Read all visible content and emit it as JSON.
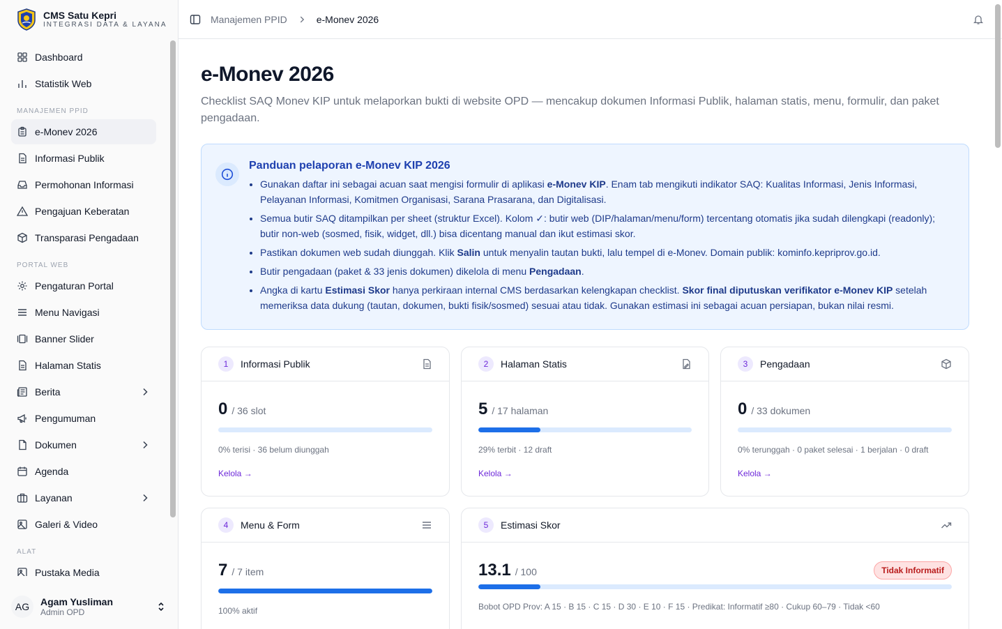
{
  "brand": {
    "title": "CMS Satu Kepri",
    "subtitle": "INTEGRASI DATA & LAYANA..."
  },
  "sidebar": {
    "top": [
      {
        "label": "Dashboard"
      },
      {
        "label": "Statistik Web"
      }
    ],
    "group_ppid": "MANAJEMEN PPID",
    "ppid": [
      {
        "label": "e-Monev 2026"
      },
      {
        "label": "Informasi Publik"
      },
      {
        "label": "Permohonan Informasi"
      },
      {
        "label": "Pengajuan Keberatan"
      },
      {
        "label": "Transparasi Pengadaan"
      }
    ],
    "group_portal": "PORTAL WEB",
    "portal": [
      {
        "label": "Pengaturan Portal"
      },
      {
        "label": "Menu Navigasi"
      },
      {
        "label": "Banner Slider"
      },
      {
        "label": "Halaman Statis"
      },
      {
        "label": "Berita"
      },
      {
        "label": "Pengumuman"
      },
      {
        "label": "Dokumen"
      },
      {
        "label": "Agenda"
      },
      {
        "label": "Layanan"
      },
      {
        "label": "Galeri & Video"
      }
    ],
    "group_alat": "ALAT",
    "alat": [
      {
        "label": "Pustaka Media"
      }
    ]
  },
  "user": {
    "initials": "AG",
    "name": "Agam Yusliman",
    "role": "Admin OPD"
  },
  "breadcrumb": {
    "parent": "Manajemen PPID",
    "current": "e-Monev 2026"
  },
  "page": {
    "title": "e-Monev 2026",
    "description": "Checklist SAQ Monev KIP untuk melaporkan bukti di website OPD — mencakup dokumen Informasi Publik, halaman statis, menu, formulir, dan paket pengadaan."
  },
  "guide": {
    "title": "Panduan pelaporan e-Monev KIP 2026",
    "b1_pre": "Gunakan daftar ini sebagai acuan saat mengisi formulir di aplikasi ",
    "b1_bold": "e-Monev KIP",
    "b1_post": ". Enam tab mengikuti indikator SAQ: Kualitas Informasi, Jenis Informasi, Pelayanan Informasi, Komitmen Organisasi, Sarana Prasarana, dan Digitalisasi.",
    "b2": "Semua butir SAQ ditampilkan per sheet (struktur Excel). Kolom ✓: butir web (DIP/halaman/menu/form) tercentang otomatis jika sudah dilengkapi (readonly); butir non-web (sosmed, fisik, widget, dll.) bisa dicentang manual dan ikut estimasi skor.",
    "b3_pre": "Pastikan dokumen web sudah diunggah. Klik ",
    "b3_bold": "Salin",
    "b3_post": " untuk menyalin tautan bukti, lalu tempel di e-Monev. Domain publik: kominfo.kepriprov.go.id.",
    "b4_pre": "Butir pengadaan (paket & 33 jenis dokumen) dikelola di menu ",
    "b4_bold": "Pengadaan",
    "b4_post": ".",
    "b5_pre": "Angka di kartu ",
    "b5_bold1": "Estimasi Skor",
    "b5_mid": " hanya perkiraan internal CMS berdasarkan kelengkapan checklist. ",
    "b5_bold2": "Skor final diputuskan verifikator e-Monev KIP",
    "b5_post": " setelah memeriksa data dukung (tautan, dokumen, bukti fisik/sosmed) sesuai atau tidak. Gunakan estimasi ini sebagai acuan persiapan, bukan nilai resmi."
  },
  "cards": [
    {
      "num": "1",
      "title": "Informasi Publik",
      "value": "0",
      "unit": "/ 36 slot",
      "progress": 0,
      "meta": "0% terisi · 36 belum diunggah",
      "link": "Kelola →"
    },
    {
      "num": "2",
      "title": "Halaman Statis",
      "value": "5",
      "unit": "/ 17 halaman",
      "progress": 29,
      "meta": "29% terbit · 12 draft",
      "link": "Kelola →"
    },
    {
      "num": "3",
      "title": "Pengadaan",
      "value": "0",
      "unit": "/ 33 dokumen",
      "progress": 0,
      "meta": "0% terunggah · 0 paket selesai · 1 berjalan · 0 draft",
      "link": "Kelola →"
    },
    {
      "num": "4",
      "title": "Menu & Form",
      "value": "7",
      "unit": "/ 7 item",
      "progress": 100,
      "meta": "100% aktif"
    },
    {
      "num": "5",
      "title": "Estimasi Skor",
      "value": "13.1",
      "unit": "/ 100",
      "progress": 13.1,
      "badge": "Tidak Informatif",
      "meta": "Bobot OPD Prov: A 15 · B 15 · C 15 · D 30 · E 10 · F 15 · Predikat: Informatif ≥80 · Cukup 60–79 · Tidak <60"
    }
  ],
  "colors": {
    "accent": "#1d6fe8",
    "track": "#dbeafe",
    "link": "#6d28d9",
    "badge_text": "#b91c1c"
  }
}
